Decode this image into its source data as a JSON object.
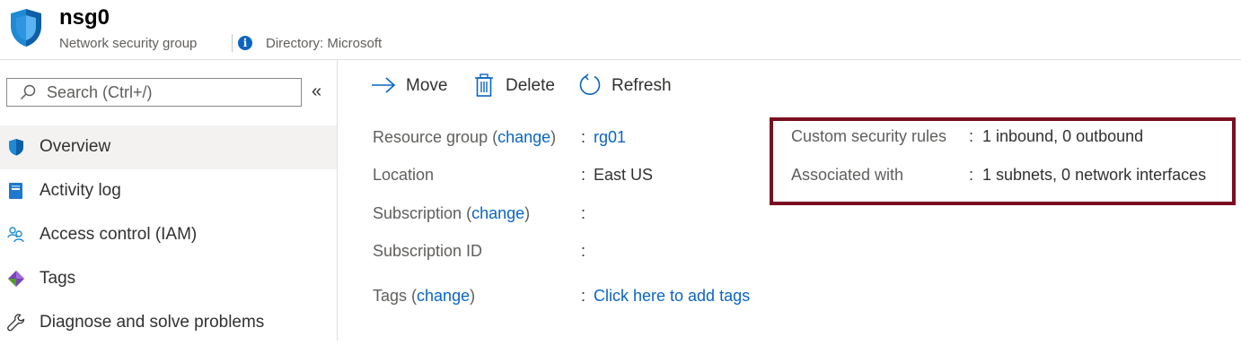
{
  "header": {
    "title": "nsg0",
    "subtitle": "Network security group",
    "directory": "Directory: Microsoft",
    "info_icon": "i"
  },
  "sidebar": {
    "search": {
      "placeholder": "Search (Ctrl+/)"
    },
    "collapse_label": "«",
    "items": [
      {
        "label": "Overview",
        "icon": "shield-icon",
        "active": true
      },
      {
        "label": "Activity log",
        "icon": "activity-log-icon"
      },
      {
        "label": "Access control (IAM)",
        "icon": "people-icon"
      },
      {
        "label": "Tags",
        "icon": "tag-icon"
      },
      {
        "label": "Diagnose and solve problems",
        "icon": "wrench-icon"
      }
    ]
  },
  "toolbar": {
    "move_label": "Move",
    "delete_label": "Delete",
    "refresh_label": "Refresh"
  },
  "essentials": {
    "resource_group": {
      "label": "Resource group",
      "change": "change",
      "value": "rg01"
    },
    "location": {
      "label": "Location",
      "value": "East US"
    },
    "subscription": {
      "label": "Subscription",
      "change": "change",
      "value": ""
    },
    "subscription_id": {
      "label": "Subscription ID",
      "value": ""
    },
    "tags": {
      "label": "Tags",
      "change": "change",
      "value": "Click here to add tags"
    },
    "custom_rules": {
      "label": "Custom security rules",
      "value": "1 inbound, 0 outbound"
    },
    "associated": {
      "label": "Associated with",
      "value": "1 subnets, 0 network interfaces"
    }
  },
  "colors": {
    "accent": "#0a65c2",
    "highlight_border": "#7a0f1f",
    "text": "#323130",
    "muted": "#605e5c"
  }
}
